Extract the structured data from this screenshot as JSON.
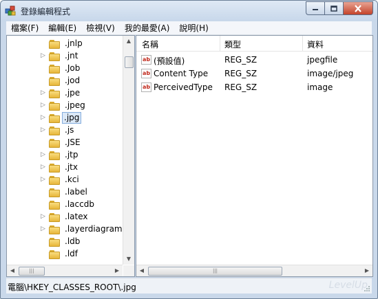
{
  "window": {
    "title": "登錄編輯程式"
  },
  "menu": [
    "檔案(F)",
    "編輯(E)",
    "檢視(V)",
    "我的最愛(A)",
    "說明(H)"
  ],
  "tree": {
    "selected_index": 6,
    "items": [
      {
        "label": ".jnlp",
        "expandable": false
      },
      {
        "label": ".jnt",
        "expandable": true
      },
      {
        "label": ".Job",
        "expandable": false
      },
      {
        "label": ".jod",
        "expandable": false
      },
      {
        "label": ".jpe",
        "expandable": true
      },
      {
        "label": ".jpeg",
        "expandable": true
      },
      {
        "label": ".jpg",
        "expandable": true
      },
      {
        "label": ".js",
        "expandable": true
      },
      {
        "label": ".JSE",
        "expandable": false
      },
      {
        "label": ".jtp",
        "expandable": true
      },
      {
        "label": ".jtx",
        "expandable": true
      },
      {
        "label": ".kci",
        "expandable": true
      },
      {
        "label": ".label",
        "expandable": false
      },
      {
        "label": ".laccdb",
        "expandable": false
      },
      {
        "label": ".latex",
        "expandable": true
      },
      {
        "label": ".layerdiagram",
        "expandable": true
      },
      {
        "label": ".ldb",
        "expandable": false
      },
      {
        "label": ".ldf",
        "expandable": false
      }
    ]
  },
  "values": {
    "columns": [
      "名稱",
      "類型",
      "資料"
    ],
    "rows": [
      {
        "name": "(預設值)",
        "type": "REG_SZ",
        "data": "jpegfile"
      },
      {
        "name": "Content Type",
        "type": "REG_SZ",
        "data": "image/jpeg"
      },
      {
        "name": "PerceivedType",
        "type": "REG_SZ",
        "data": "image"
      }
    ]
  },
  "status": {
    "path": "電腦\\HKEY_CLASSES_ROOT\\.jpg",
    "watermark": "LevelUp"
  },
  "icons": {
    "string_value": "ab"
  }
}
